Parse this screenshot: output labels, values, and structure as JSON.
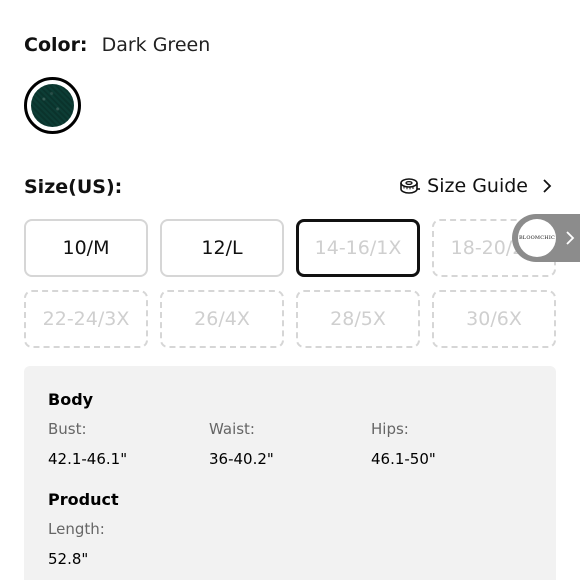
{
  "color": {
    "label": "Color:",
    "value": "Dark Green",
    "swatch_hex": "#0d3d35"
  },
  "size": {
    "label": "Size(US):",
    "guide_label": "Size Guide",
    "options": [
      {
        "label": "10/M",
        "state": "available"
      },
      {
        "label": "12/L",
        "state": "available"
      },
      {
        "label": "14-16/1X",
        "state": "selected-out-of-stock"
      },
      {
        "label": "18-20/2X",
        "state": "out-of-stock"
      },
      {
        "label": "22-24/3X",
        "state": "out-of-stock"
      },
      {
        "label": "26/4X",
        "state": "out-of-stock"
      },
      {
        "label": "28/5X",
        "state": "out-of-stock"
      },
      {
        "label": "30/6X",
        "state": "out-of-stock"
      }
    ]
  },
  "brand_tab": {
    "logo_text": "BLOOMCHIC"
  },
  "measurements": {
    "body": {
      "title": "Body",
      "items": [
        {
          "label": "Bust:",
          "value": "42.1-46.1\""
        },
        {
          "label": "Waist:",
          "value": "36-40.2\""
        },
        {
          "label": "Hips:",
          "value": "46.1-50\""
        }
      ]
    },
    "product": {
      "title": "Product",
      "items": [
        {
          "label": "Length:",
          "value": "52.8\""
        }
      ]
    }
  },
  "colors": {
    "text": "#111111",
    "panel_bg": "#f2f2f2",
    "disabled_text": "#cfcfcf",
    "border": "#d6d6d6"
  }
}
